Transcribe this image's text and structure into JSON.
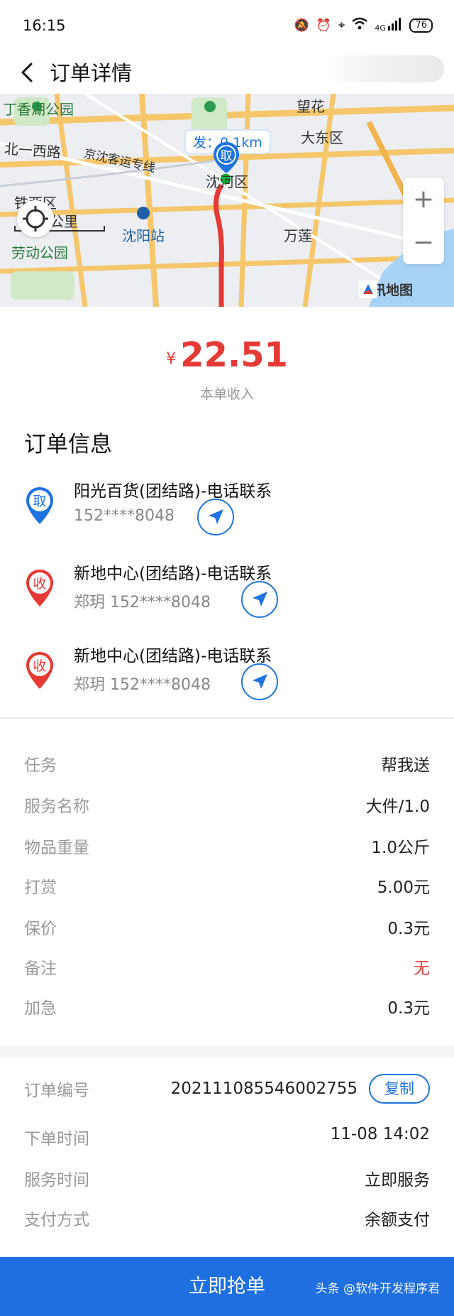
{
  "status_bar": {
    "time": "16:15",
    "battery": "76",
    "network": "4G"
  },
  "header": {
    "title": "订单详情"
  },
  "map": {
    "labels": [
      "丁香湖公园",
      "北一西路",
      "京沈客运专线",
      "铁西区",
      "公里",
      "劳动公园",
      "沈阳站",
      "沈河区",
      "望花",
      "大东区",
      "万莲",
      "腾讯地图"
    ],
    "distance_bubble": "发：0.1km",
    "pickup_marker": "取"
  },
  "income": {
    "currency": "¥",
    "amount": "22.51",
    "label": "本单收入"
  },
  "order_info": {
    "title": "订单信息",
    "stops": [
      {
        "type": "pickup",
        "badge": "取",
        "name": "阳光百货(团结路)-电话联系",
        "contact": "152****8048"
      },
      {
        "type": "delivery",
        "badge": "收",
        "name": "新地中心(团结路)-电话联系",
        "contact": "郑玥  152****8048"
      },
      {
        "type": "delivery",
        "badge": "收",
        "name": "新地中心(团结路)-电话联系",
        "contact": "郑玥  152****8048"
      }
    ]
  },
  "details": [
    {
      "label": "任务",
      "value": "帮我送"
    },
    {
      "label": "服务名称",
      "value": "大件/1.0"
    },
    {
      "label": "物品重量",
      "value": "1.0公斤"
    },
    {
      "label": "打赏",
      "value": "5.00元"
    },
    {
      "label": "保价",
      "value": "0.3元"
    },
    {
      "label": "备注",
      "value": "无"
    },
    {
      "label": "加急",
      "value": "0.3元"
    }
  ],
  "meta": {
    "order_no_label": "订单编号",
    "order_no": "202111085546002755",
    "copy_label": "复制",
    "order_time_label": "下单时间",
    "order_time": "11-08 14:02",
    "service_time_label": "服务时间",
    "service_time": "立即服务",
    "payment_label": "支付方式",
    "payment": "余额支付"
  },
  "action": {
    "grab_label": "立即抢单"
  },
  "watermark": "头条 @软件开发程序君",
  "colors": {
    "primary": "#1f6fe0",
    "price": "#e53935",
    "pickup_pin": "#1f73e0",
    "delivery_pin": "#e53935"
  }
}
